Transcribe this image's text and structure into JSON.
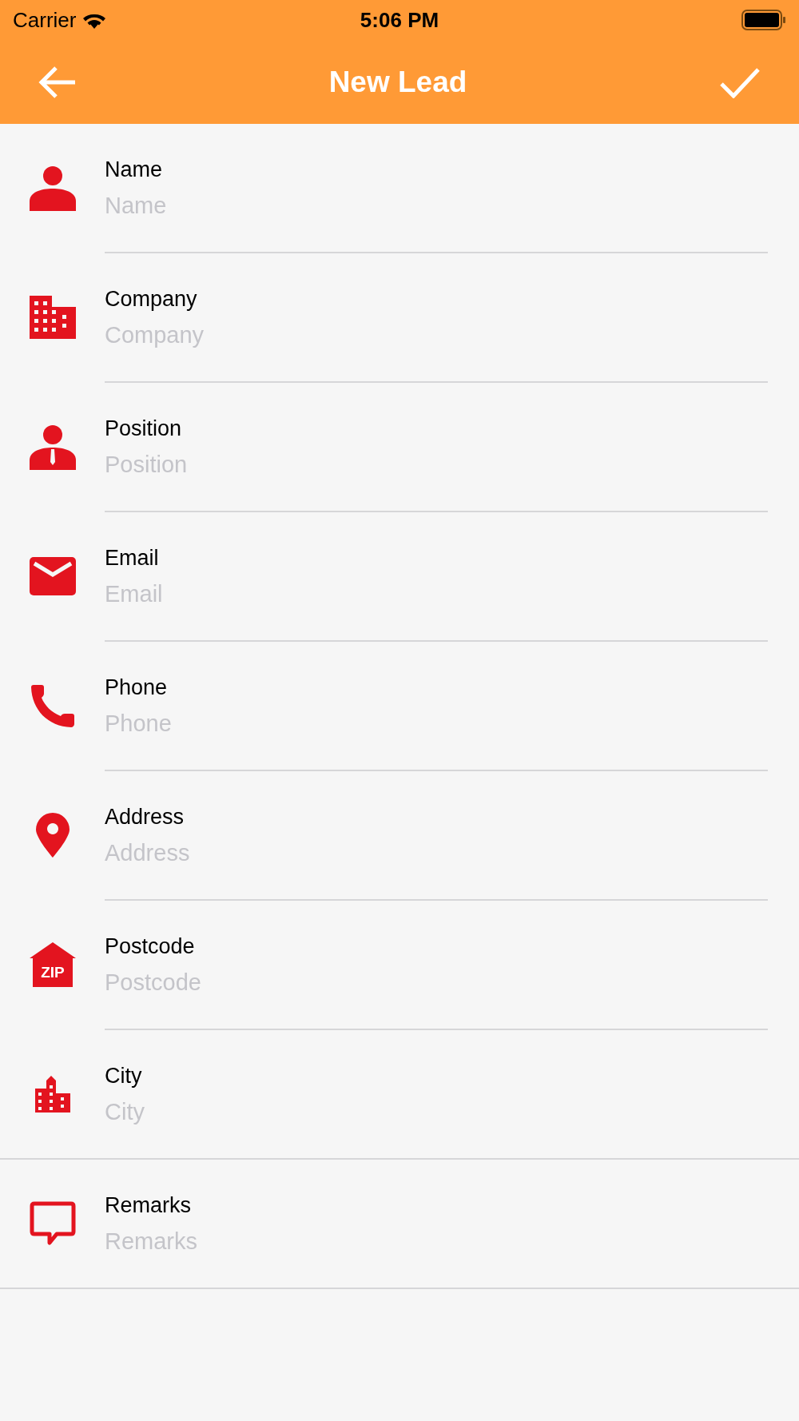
{
  "status_bar": {
    "carrier": "Carrier",
    "time": "5:06 PM"
  },
  "header": {
    "title": "New Lead"
  },
  "sections": [
    {
      "fields": [
        {
          "kind": "person",
          "label": "Name",
          "placeholder": "Name"
        },
        {
          "kind": "building",
          "label": "Company",
          "placeholder": "Company"
        },
        {
          "kind": "person-tie",
          "label": "Position",
          "placeholder": "Position"
        },
        {
          "kind": "mail",
          "label": "Email",
          "placeholder": "Email"
        },
        {
          "kind": "phone",
          "label": "Phone",
          "placeholder": "Phone"
        },
        {
          "kind": "pin",
          "label": "Address",
          "placeholder": "Address"
        },
        {
          "kind": "zip",
          "icon_text": "ZIP",
          "label": "Postcode",
          "placeholder": "Postcode"
        },
        {
          "kind": "city",
          "label": "City",
          "placeholder": "City"
        }
      ]
    },
    {
      "fields": [
        {
          "kind": "chat",
          "label": "Remarks",
          "placeholder": "Remarks"
        }
      ]
    }
  ]
}
